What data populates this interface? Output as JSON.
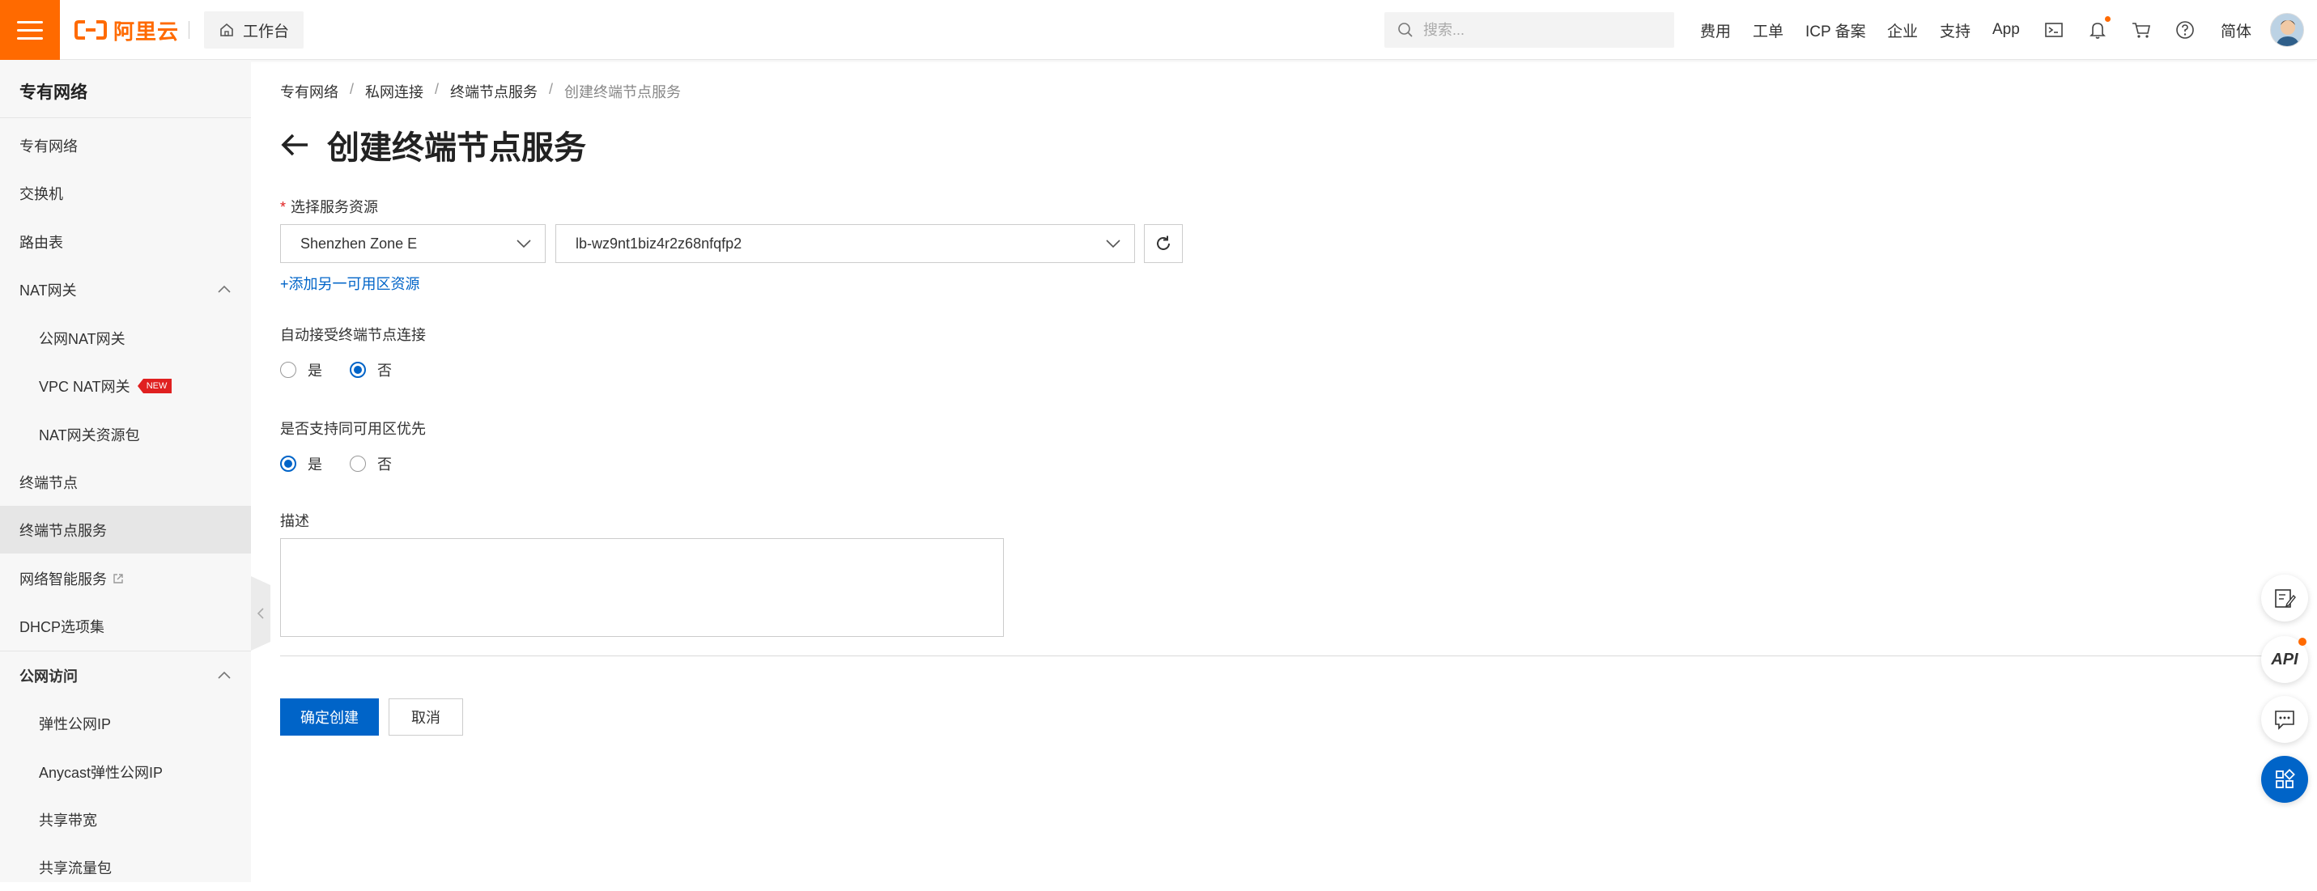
{
  "topbar": {
    "brand": "阿里云",
    "workbench_label": "工作台",
    "search_placeholder": "搜索...",
    "nav": [
      "费用",
      "工单",
      "ICP 备案",
      "企业",
      "支持",
      "App"
    ],
    "lang_label": "简体",
    "accent_color": "#ff6a00"
  },
  "sidebar": {
    "title": "专有网络",
    "items": [
      {
        "label": "专有网络"
      },
      {
        "label": "交换机"
      },
      {
        "label": "路由表"
      },
      {
        "label": "NAT网关"
      },
      {
        "label": "公网NAT网关"
      },
      {
        "label": "VPC NAT网关",
        "badge": "NEW"
      },
      {
        "label": "NAT网关资源包"
      },
      {
        "label": "终端节点"
      },
      {
        "label": "终端节点服务"
      },
      {
        "label": "网络智能服务"
      },
      {
        "label": "DHCP选项集"
      },
      {
        "label": "公网访问"
      },
      {
        "label": "弹性公网IP"
      },
      {
        "label": "Anycast弹性公网IP"
      },
      {
        "label": "共享带宽"
      },
      {
        "label": "共享流量包"
      }
    ]
  },
  "breadcrumb": [
    "专有网络",
    "私网连接",
    "终端节点服务",
    "创建终端节点服务"
  ],
  "page_title": "创建终端节点服务",
  "form": {
    "resource_label": "选择服务资源",
    "zone_value": "Shenzhen Zone E",
    "lb_value": "lb-wz9nt1biz4r2z68nfqfp2",
    "add_zone_link": "+添加另一可用区资源",
    "auto_accept_label": "自动接受终端节点连接",
    "auto_accept_options": [
      "是",
      "否"
    ],
    "auto_accept_selected": "否",
    "zone_affinity_label": "是否支持同可用区优先",
    "zone_affinity_options": [
      "是",
      "否"
    ],
    "zone_affinity_selected": "是",
    "description_label": "描述",
    "description_value": "",
    "confirm_label": "确定创建",
    "cancel_label": "取消",
    "primary_color": "#0064c8"
  },
  "float_tools": {
    "api_label": "API"
  }
}
